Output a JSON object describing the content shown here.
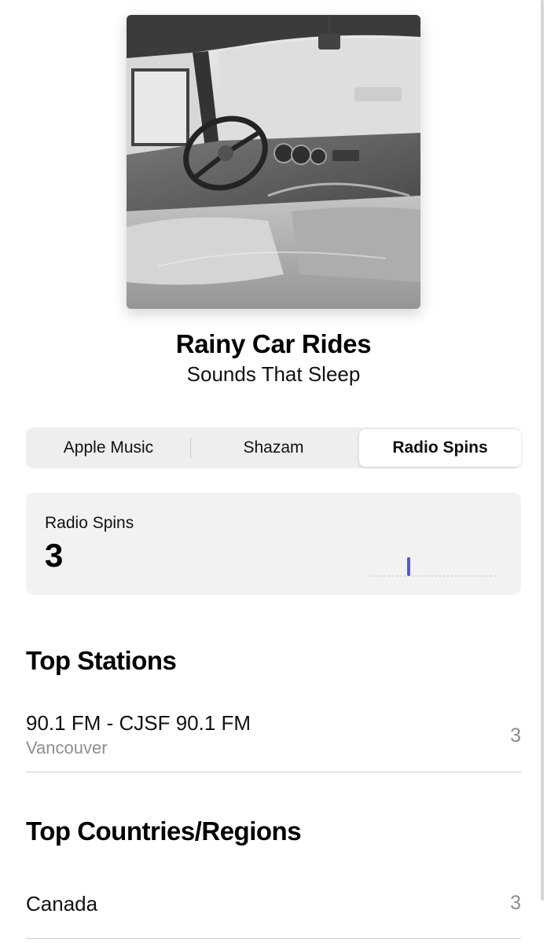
{
  "song": {
    "title": "Rainy Car Rides",
    "artist": "Sounds That Sleep",
    "artwork_icon": "vintage-car-interior-photo",
    "more_icon": "ellipsis-icon"
  },
  "segmented_control": {
    "tabs": [
      {
        "label": "Apple Music",
        "selected": false
      },
      {
        "label": "Shazam",
        "selected": false
      },
      {
        "label": "Radio Spins",
        "selected": true
      }
    ]
  },
  "stats_card": {
    "label": "Radio Spins",
    "value": "3",
    "spark_color": "#5856d6"
  },
  "top_stations": {
    "title": "Top Stations",
    "items": [
      {
        "name": "90.1 FM - CJSF 90.1 FM",
        "location": "Vancouver",
        "count": "3"
      }
    ]
  },
  "top_regions": {
    "title": "Top Countries/Regions",
    "items": [
      {
        "name": "Canada",
        "count": "3"
      }
    ]
  }
}
